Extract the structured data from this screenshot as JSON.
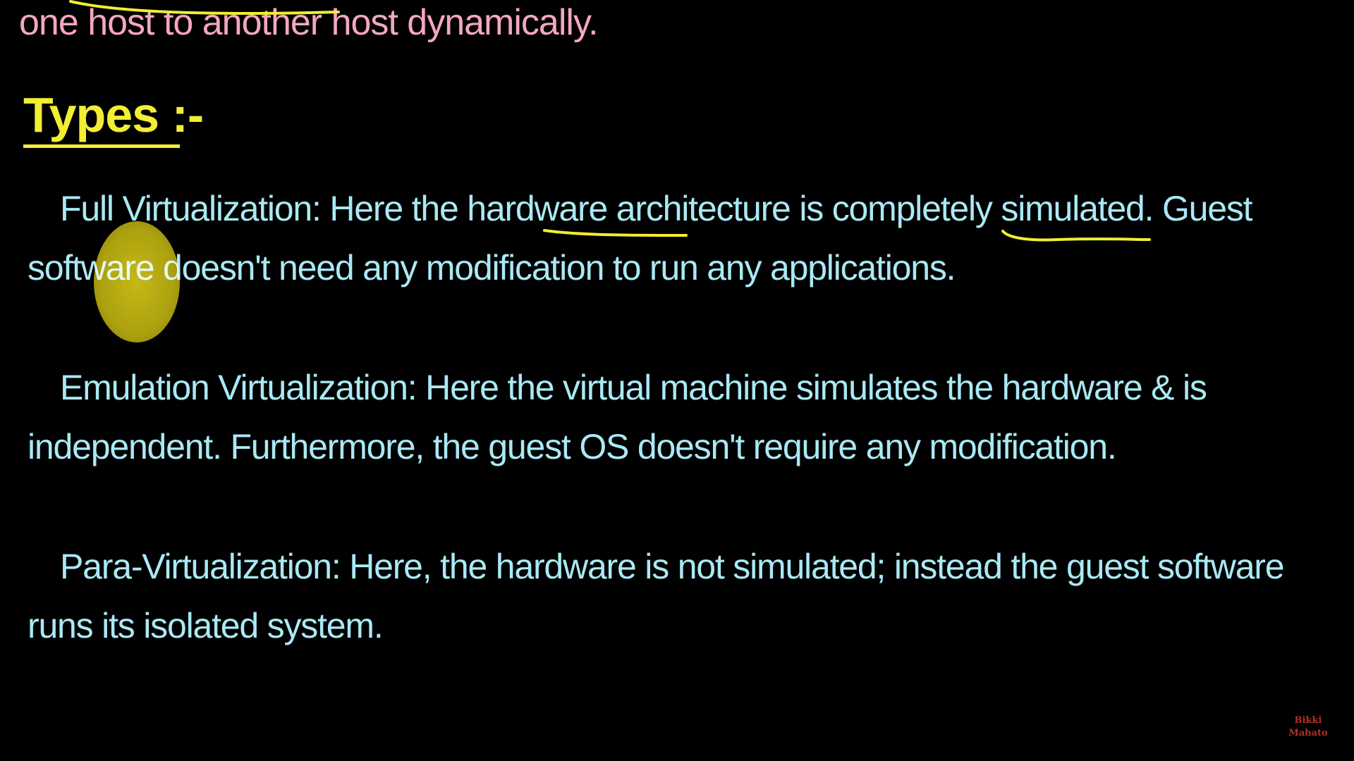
{
  "slide": {
    "top_line": "one host to another host dynamically.",
    "heading": "Types :-",
    "paragraphs": [
      {
        "text": "Full Virtualization: Here the hardware architecture is completely simulated. Guest software doesn't need any modification to run any applications."
      },
      {
        "text": "Emulation Virtualization: Here the virtual machine simulates the hardware & is independent. Furthermore, the guest OS doesn't require any modification."
      },
      {
        "text": "Para-Virtualization: Here, the hardware is not simulated; instead the guest software runs its isolated system."
      }
    ],
    "watermark": "Bikki Mahato"
  },
  "colors": {
    "background": "#000000",
    "top_line_text": "#f4a7bf",
    "heading_text": "#f2ee33",
    "body_text": "#a9e9f4",
    "annotation_ink": "#f2ee33",
    "cursor_highlight": "#d6c816",
    "watermark_text": "#b0322b"
  }
}
